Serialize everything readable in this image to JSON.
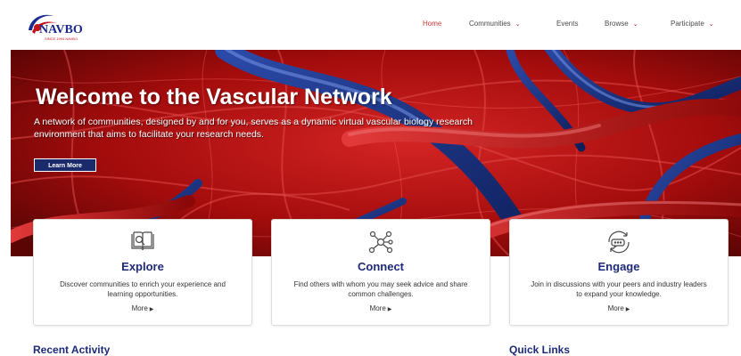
{
  "brand": {
    "name": "NAVBO",
    "tagline": "SINCE 1994 NAVBO",
    "accent": "#1a2a8c",
    "secondary": "#c0141c"
  },
  "nav": {
    "items": [
      {
        "label": "Home",
        "active": true,
        "dropdown": false
      },
      {
        "label": "Communities",
        "active": false,
        "dropdown": true
      },
      {
        "label": "Events",
        "active": false,
        "dropdown": false
      },
      {
        "label": "Browse",
        "active": false,
        "dropdown": true
      },
      {
        "label": "Participate",
        "active": false,
        "dropdown": true
      }
    ],
    "caret_icon": "chevron-down-icon"
  },
  "hero": {
    "title": "Welcome to the Vascular Network",
    "subtitle": "A network of communities, designed by and for you, serves as a dynamic virtual vascular biology research environment that aims to facilitate your research needs.",
    "button_label": "Learn More",
    "background_color": "#a50f0f"
  },
  "cards": [
    {
      "title": "Explore",
      "icon": "book-search-icon",
      "description": "Discover communities to enrich your experience and learning opportunities.",
      "more_label": "More"
    },
    {
      "title": "Connect",
      "icon": "network-icon",
      "description": "Find others with whom you may seek advice and share common challenges.",
      "more_label": "More"
    },
    {
      "title": "Engage",
      "icon": "chat-cycle-icon",
      "description": "Join in discussions with your peers and industry leaders to expand your knowledge.",
      "more_label": "More"
    }
  ],
  "sections": {
    "recent_activity": "Recent Activity",
    "quick_links": "Quick Links"
  },
  "colors": {
    "heading_blue": "#1e2a78",
    "nav_active": "#d23a3a",
    "button_bg": "#1b2a6b"
  }
}
